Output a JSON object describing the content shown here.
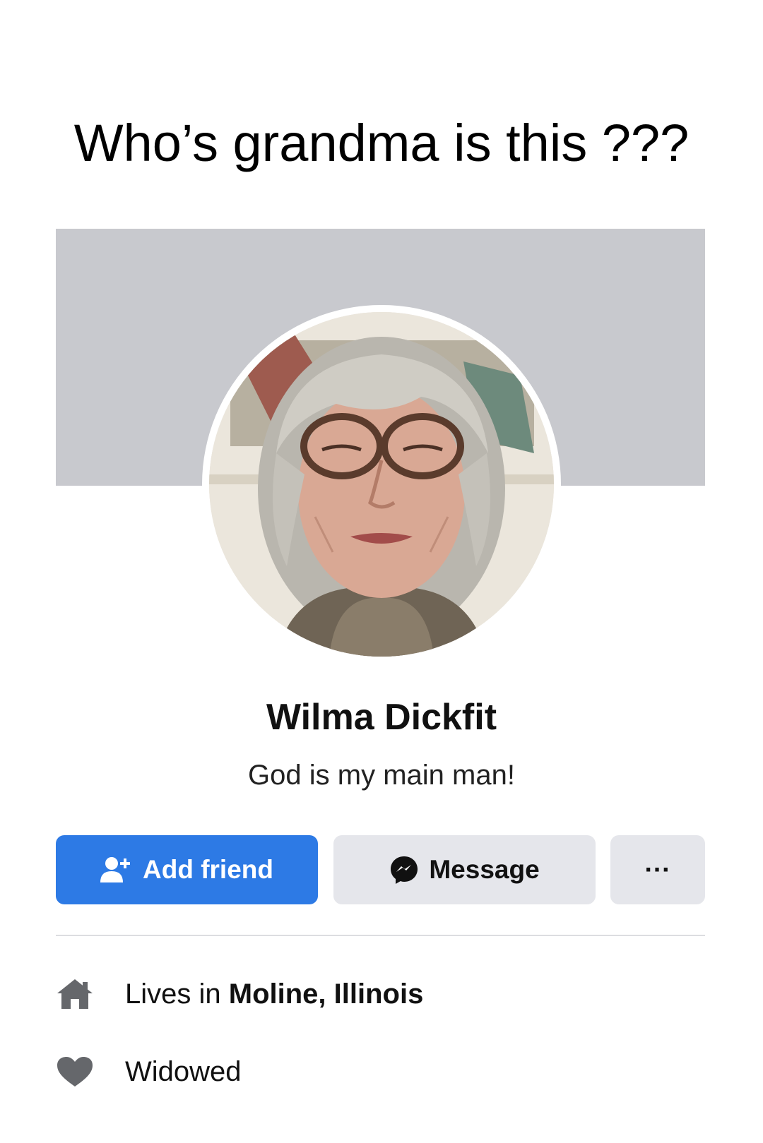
{
  "caption": "Who’s grandma is this ???",
  "profile": {
    "name": "Wilma Dickfit",
    "bio": "God is my main man!",
    "avatar_icon": "profile-photo"
  },
  "actions": {
    "add_friend": {
      "label": "Add friend",
      "icon": "add-person-icon"
    },
    "message": {
      "label": "Message",
      "icon": "messenger-icon"
    },
    "more": {
      "label": "···",
      "icon": "more-options-icon"
    }
  },
  "details": {
    "lives": {
      "prefix": "Lives in ",
      "place": "Moline, Illinois",
      "icon": "home-icon"
    },
    "relationship": {
      "label": "Widowed",
      "icon": "heart-icon"
    }
  },
  "colors": {
    "accent": "#2d7ae5",
    "cover": "#c8c9ce",
    "button_gray": "#e5e6eb",
    "icon_gray": "#65676b"
  }
}
